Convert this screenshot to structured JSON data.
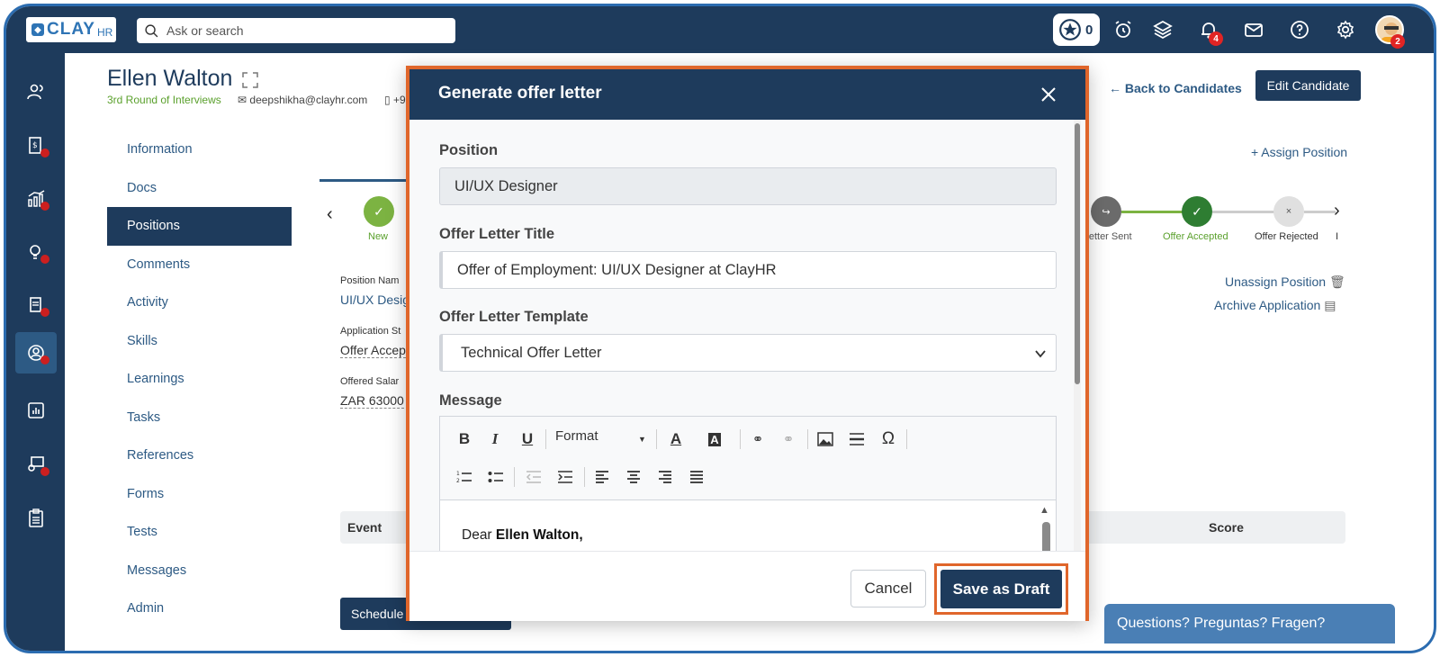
{
  "topbar": {
    "logo_text": "CLAY",
    "logo_suffix": "HR",
    "search_placeholder": "Ask or search",
    "star_count": "0",
    "notification_count": "4",
    "avatar_badge": "2"
  },
  "candidate": {
    "name": "Ellen Walton",
    "stage": "3rd Round of Interviews",
    "email": "deepshikha@clayhr.com",
    "phone": "+9"
  },
  "header_actions": {
    "back_link": "Back to Candidates",
    "edit_button": "Edit Candidate"
  },
  "subnav": [
    {
      "label": "Information"
    },
    {
      "label": "Docs"
    },
    {
      "label": "Positions"
    },
    {
      "label": "Comments"
    },
    {
      "label": "Activity"
    },
    {
      "label": "Skills"
    },
    {
      "label": "Learnings"
    },
    {
      "label": "Tasks"
    },
    {
      "label": "References"
    },
    {
      "label": "Forms"
    },
    {
      "label": "Tests"
    },
    {
      "label": "Messages"
    },
    {
      "label": "Admin"
    }
  ],
  "position_panel": {
    "assign_link": "+ Assign Position",
    "unassign_link": "Unassign Position",
    "archive_link": "Archive Application",
    "steps": [
      {
        "label": "New",
        "status": "done"
      },
      {
        "label": "r Letter Sent",
        "status": "neutral"
      },
      {
        "label": "Offer Accepted",
        "status": "done"
      },
      {
        "label": "Offer Rejected",
        "status": "rejected"
      },
      {
        "label": "I",
        "status": "none"
      }
    ],
    "fields": [
      {
        "label": "Position Nam",
        "value": "UI/UX Desig"
      },
      {
        "label": "Application St",
        "value": "Offer Accep"
      },
      {
        "label": "Offered Salar",
        "value": "ZAR 63000"
      }
    ],
    "table_headers": {
      "event": "Event",
      "score": "Score"
    },
    "schedule_button": "Schedule"
  },
  "help_widget": "Questions? Preguntas? Fragen?",
  "modal": {
    "title": "Generate offer letter",
    "position_label": "Position",
    "position_value": "UI/UX Designer",
    "title_label": "Offer Letter Title",
    "title_value": "Offer of Employment: UI/UX Designer at ClayHR",
    "template_label": "Offer Letter Template",
    "template_value": "Technical Offer Letter",
    "message_label": "Message",
    "toolbar_format": "Format",
    "message_greeting": "Dear",
    "message_name": "Ellen Walton",
    "message_comma": ",",
    "cancel_button": "Cancel",
    "save_button": "Save as Draft"
  },
  "colors": {
    "navy": "#1e3b5c",
    "link": "#2d5a84",
    "accent_orange": "#e0662b",
    "success_green": "#5aa02c",
    "badge_red": "#e02424"
  }
}
